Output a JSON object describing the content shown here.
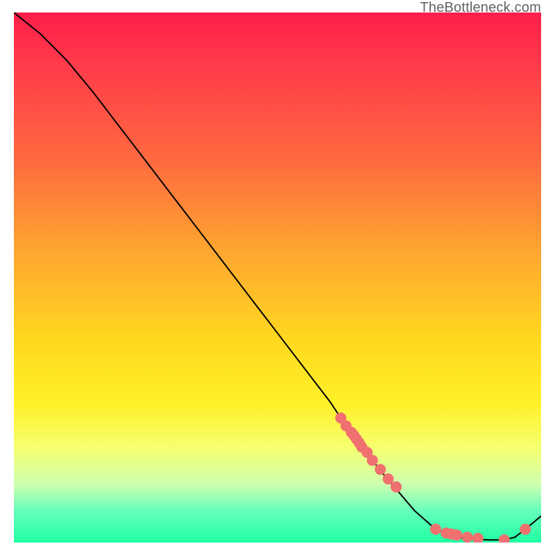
{
  "watermark": "TheBottleneck.com",
  "chart_data": {
    "type": "line",
    "title": "",
    "xlabel": "",
    "ylabel": "",
    "xlim": [
      0,
      100
    ],
    "ylim": [
      0,
      100
    ],
    "line": {
      "x": [
        0,
        5,
        10,
        15,
        20,
        25,
        30,
        35,
        40,
        45,
        50,
        55,
        60,
        63,
        66,
        68,
        70,
        73,
        76,
        80,
        85,
        90,
        93,
        95,
        97,
        100
      ],
      "y": [
        100,
        96,
        91,
        85,
        78.5,
        72,
        65.5,
        59,
        52.5,
        46,
        39.5,
        33,
        26.5,
        22,
        18,
        15.5,
        13,
        9.5,
        6,
        2.5,
        0.8,
        0.5,
        0.5,
        1.0,
        2.5,
        5
      ]
    },
    "dots": {
      "x": [
        62,
        63,
        64,
        64.5,
        65,
        65.5,
        66,
        67,
        68,
        69.5,
        71,
        72.5,
        80,
        82,
        83,
        84,
        86,
        88,
        93,
        97
      ],
      "y": [
        23.5,
        22,
        20.8,
        20.2,
        19.5,
        18.8,
        18,
        17,
        15.5,
        13.8,
        12,
        10.5,
        2.5,
        1.8,
        1.6,
        1.4,
        1.0,
        0.8,
        0.5,
        2.5
      ]
    },
    "colors": {
      "line": "#000000",
      "dots": "#f07070"
    }
  }
}
